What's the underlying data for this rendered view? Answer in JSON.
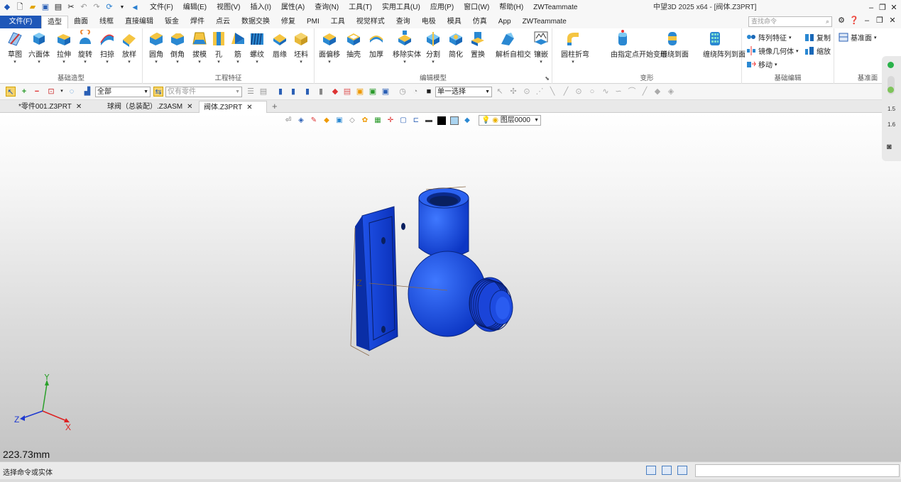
{
  "app": {
    "title": "中望3D 2025 x64 - [阀体.Z3PRT]"
  },
  "menu": [
    "文件(F)",
    "编辑(E)",
    "视图(V)",
    "插入(I)",
    "属性(A)",
    "查询(N)",
    "工具(T)",
    "实用工具(U)",
    "应用(P)",
    "窗口(W)",
    "帮助(H)",
    "ZWTeammate"
  ],
  "ribbon_tabs": [
    "文件(F)",
    "造型",
    "曲面",
    "线框",
    "直接编辑",
    "钣金",
    "焊件",
    "点云",
    "数据交换",
    "修复",
    "PMI",
    "工具",
    "视觉样式",
    "查询",
    "电极",
    "模具",
    "仿真",
    "App",
    "ZWTeammate"
  ],
  "search": {
    "placeholder": "查找命令"
  },
  "groups": {
    "basic_modeling": {
      "label": "基础造型",
      "tools": [
        "草图",
        "六面体",
        "拉伸",
        "旋转",
        "扫掠",
        "放样"
      ]
    },
    "engineering": {
      "label": "工程特征",
      "tools": [
        "圆角",
        "倒角",
        "拔模",
        "孔",
        "筋",
        "螺纹",
        "唇缘",
        "坯料"
      ]
    },
    "edit_model": {
      "label": "编辑模型",
      "tools": [
        "面偏移",
        "抽壳",
        "加厚",
        "移除实体",
        "分割",
        "简化",
        "置换",
        "解析自相交",
        "镶嵌"
      ]
    },
    "deform": {
      "label": "变形",
      "tools": [
        "圆柱折弯",
        "由指定点开始变形",
        "缠绕到面",
        "缠绕阵列到面"
      ]
    },
    "basic_edit": {
      "label": "基础编辑",
      "tools": [
        "阵列特征",
        "复制",
        "镜像几何体",
        "缩放",
        "移动"
      ]
    },
    "datum": {
      "label": "基准面",
      "tools": [
        "基准面"
      ]
    }
  },
  "filter": {
    "all": "全部",
    "parts": "仅有零件",
    "select_mode": "单一选择"
  },
  "doc_tabs": [
    "*零件001.Z3PRT",
    "球阀（总装配）.Z3ASM",
    "阀体.Z3PRT"
  ],
  "view": {
    "layer": "图层0000",
    "scale": "223.73mm",
    "axes": {
      "x": "X",
      "y": "Y",
      "z": "Z"
    },
    "side_zoom": [
      "1.5",
      "1.6"
    ]
  },
  "status": {
    "prompt": "选择命令或实体"
  },
  "colors": {
    "accent": "#1f57b8",
    "model": "#1a4fe0"
  }
}
